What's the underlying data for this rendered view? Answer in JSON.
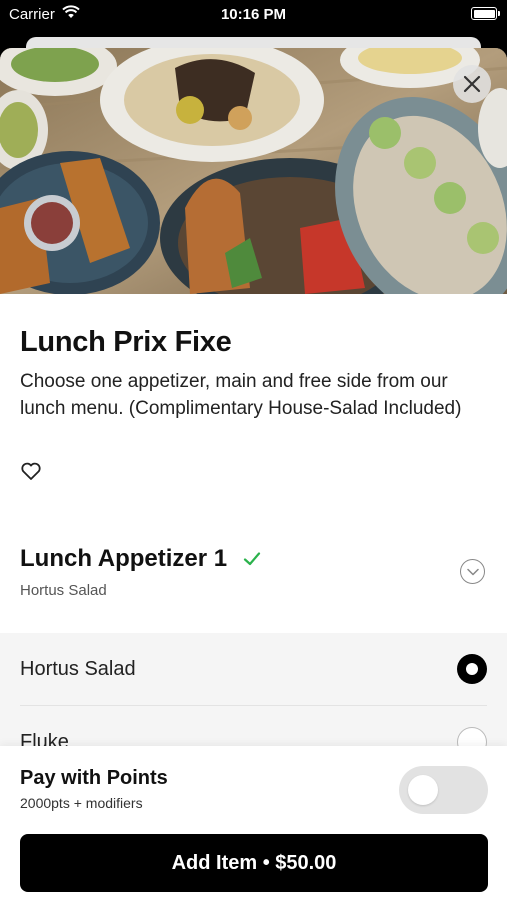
{
  "status_bar": {
    "carrier": "Carrier",
    "time": "10:16 PM"
  },
  "icons": {
    "wifi": "wifi-icon",
    "battery": "battery-icon",
    "close": "close-icon",
    "heart": "heart-icon",
    "check": "checkmark-icon",
    "chevron": "chevron-down-icon"
  },
  "item": {
    "title": "Lunch Prix Fixe",
    "description": "Choose one appetizer, main and free side from our lunch menu. (Complimentary House-Salad Included)"
  },
  "group": {
    "title": "Lunch Appetizer 1",
    "selected_summary": "Hortus Salad",
    "check_color": "#2bb24c"
  },
  "options": [
    {
      "label": "Hortus Salad",
      "selected": true
    },
    {
      "label": "Fluke",
      "selected": false
    }
  ],
  "points": {
    "title": "Pay with Points",
    "subtitle": "2000pts + modifiers",
    "enabled": false
  },
  "add_button": {
    "label": "Add Item • $50.00"
  },
  "colors": {
    "primary": "#000000",
    "toggle_off": "#e2e2e2",
    "options_bg": "#f5f5f5"
  }
}
